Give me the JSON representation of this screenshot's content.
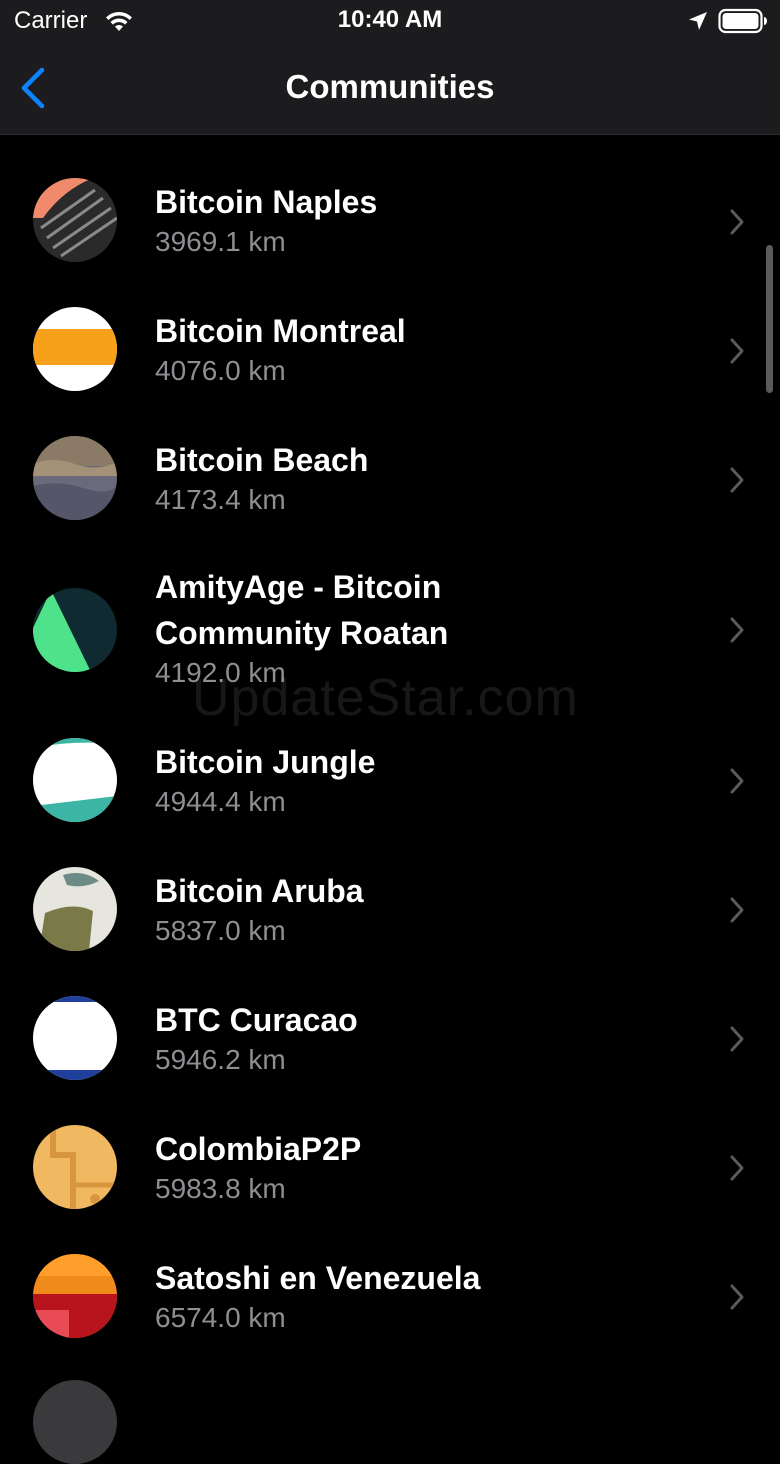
{
  "status_bar": {
    "carrier": "Carrier",
    "time": "10:40 AM"
  },
  "nav": {
    "title": "Communities"
  },
  "communities": [
    {
      "name": "Bitcoin Naples",
      "distance": "3969.1 km",
      "icon": "bitcoin-naples-avatar"
    },
    {
      "name": "Bitcoin Montreal",
      "distance": "4076.0 km",
      "icon": "bitcoin-montreal-avatar"
    },
    {
      "name": "Bitcoin Beach",
      "distance": "4173.4 km",
      "icon": "bitcoin-beach-avatar"
    },
    {
      "name_line1": "AmityAge - Bitcoin",
      "name_line2": "Community Roatan",
      "distance": "4192.0 km",
      "icon": "amityage-avatar"
    },
    {
      "name": "Bitcoin Jungle",
      "distance": "4944.4 km",
      "icon": "bitcoin-jungle-avatar"
    },
    {
      "name": "Bitcoin Aruba",
      "distance": "5837.0 km",
      "icon": "bitcoin-aruba-avatar"
    },
    {
      "name": "BTC Curacao",
      "distance": "5946.2 km",
      "icon": "btc-curacao-avatar"
    },
    {
      "name": "ColombiaP2P",
      "distance": "5983.8 km",
      "icon": "colombiap2p-avatar"
    },
    {
      "name": "Satoshi en Venezuela",
      "distance": "6574.0 km",
      "icon": "satoshi-venezuela-avatar"
    }
  ],
  "watermark": "UpdateStar.com",
  "colors": {
    "background": "#000000",
    "bar": "#1c1c1e",
    "accent": "#0a84ff",
    "secondary_text": "#8e8e93"
  }
}
